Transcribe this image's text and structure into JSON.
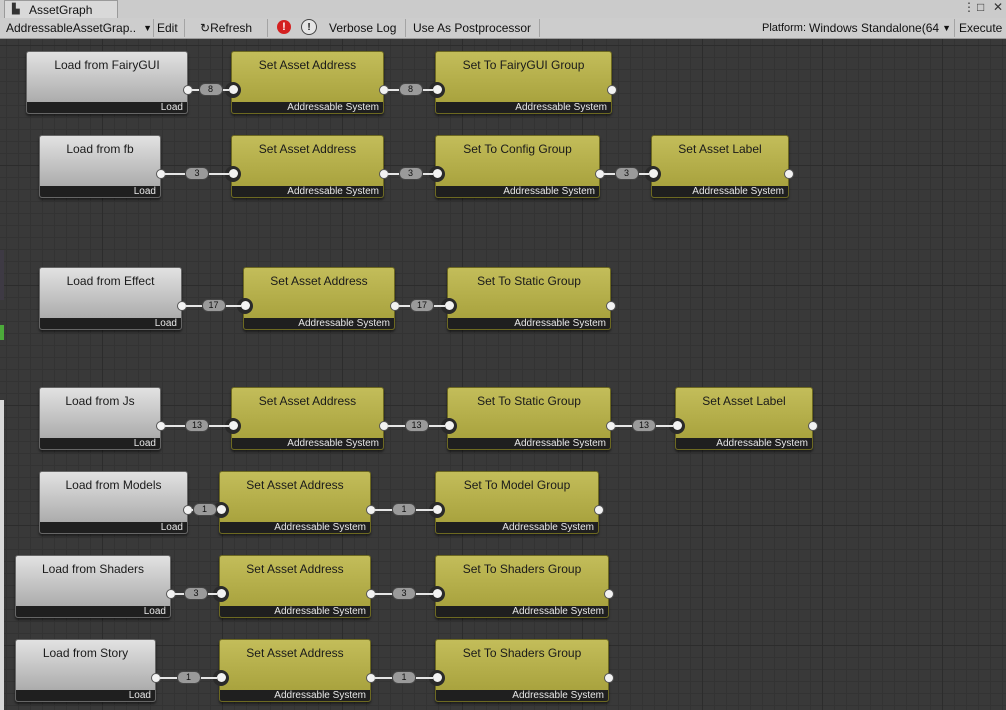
{
  "window": {
    "tab_title": "AssetGraph",
    "menu_glyph": "⋮",
    "maximize_glyph": "□",
    "close_glyph": "✕"
  },
  "toolbar": {
    "graph_select": "AddressableAssetGrap..",
    "edit": "Edit",
    "refresh": "Refresh",
    "verbose_log": "Verbose Log",
    "use_as_postprocessor": "Use As Postprocessor",
    "platform_label": "Platform:",
    "platform_value": "Windows Standalone(64",
    "execute": "Execute"
  },
  "colors": {
    "load_node": "#b5b5b5",
    "addressable_node": "#b3ad48",
    "canvas": "#393939"
  },
  "footers": {
    "load": "Load",
    "addressable": "Addressable System"
  },
  "rows": [
    {
      "nodes": [
        {
          "title": "Load from FairyGUI",
          "type": "load"
        },
        {
          "title": "Set Asset Address",
          "type": "addressable"
        },
        {
          "title": "Set To FairyGUI Group",
          "type": "addressable"
        }
      ],
      "counts": [
        "8",
        "8"
      ]
    },
    {
      "nodes": [
        {
          "title": "Load from fb",
          "type": "load"
        },
        {
          "title": "Set Asset Address",
          "type": "addressable"
        },
        {
          "title": "Set To Config Group",
          "type": "addressable"
        },
        {
          "title": "Set Asset Label",
          "type": "addressable"
        }
      ],
      "counts": [
        "3",
        "3",
        "3"
      ]
    },
    {
      "nodes": [
        {
          "title": "Load from Effect",
          "type": "load"
        },
        {
          "title": "Set Asset Address",
          "type": "addressable"
        },
        {
          "title": "Set  To Static Group",
          "type": "addressable"
        }
      ],
      "counts": [
        "17",
        "17"
      ]
    },
    {
      "nodes": [
        {
          "title": "Load from Js",
          "type": "load"
        },
        {
          "title": "Set Asset Address",
          "type": "addressable"
        },
        {
          "title": "Set  To Static Group",
          "type": "addressable"
        },
        {
          "title": "Set Asset Label",
          "type": "addressable"
        }
      ],
      "counts": [
        "13",
        "13",
        "13"
      ]
    },
    {
      "nodes": [
        {
          "title": "Load from Models",
          "type": "load"
        },
        {
          "title": "Set Asset Address",
          "type": "addressable"
        },
        {
          "title": "Set To Model Group",
          "type": "addressable"
        }
      ],
      "counts": [
        "1",
        "1"
      ]
    },
    {
      "nodes": [
        {
          "title": "Load from Shaders",
          "type": "load"
        },
        {
          "title": "Set Asset Address",
          "type": "addressable"
        },
        {
          "title": "Set To Shaders Group",
          "type": "addressable"
        }
      ],
      "counts": [
        "3",
        "3"
      ]
    },
    {
      "nodes": [
        {
          "title": "Load from Story",
          "type": "load"
        },
        {
          "title": "Set Asset Address",
          "type": "addressable"
        },
        {
          "title": "Set To Shaders Group",
          "type": "addressable"
        }
      ],
      "counts": [
        "1",
        "1"
      ]
    }
  ]
}
